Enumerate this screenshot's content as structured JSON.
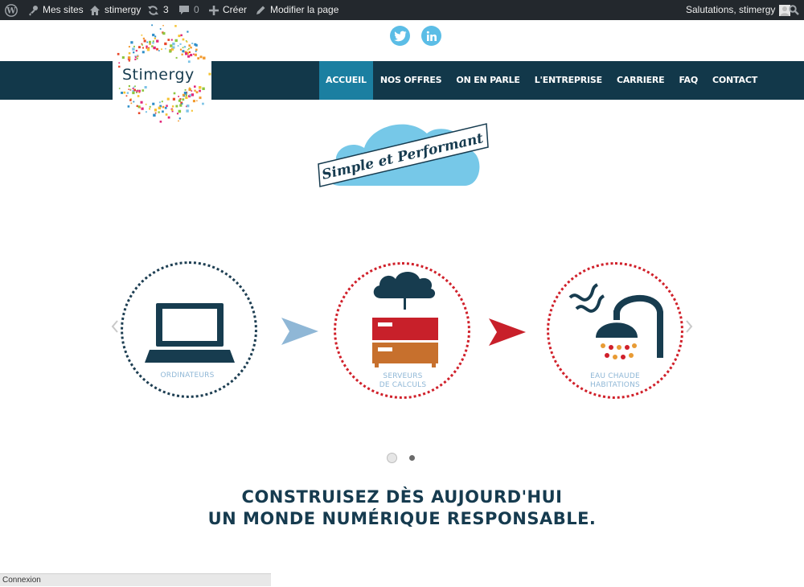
{
  "admin_bar": {
    "wp_logo_icon": "wordpress-icon",
    "my_sites": "Mes sites",
    "site_name": "stimergy",
    "updates_count": "3",
    "comments_count": "0",
    "new_label": "Créer",
    "edit_label": "Modifier la page",
    "greeting": "Salutations, stimergy"
  },
  "logo": {
    "text": "Stimergy"
  },
  "social": {
    "twitter": "twitter-icon",
    "linkedin": "linkedin-icon"
  },
  "nav": {
    "items": [
      {
        "label": "ACCUEIL",
        "active": true
      },
      {
        "label": "NOS OFFRES"
      },
      {
        "label": "ON EN PARLE"
      },
      {
        "label": "L'ENTREPRISE"
      },
      {
        "label": "CARRIERE"
      },
      {
        "label": "FAQ"
      },
      {
        "label": "CONTACT"
      }
    ]
  },
  "tagline": "Simple et Performant",
  "slider": {
    "captions": {
      "computers": "ORDINATEURS",
      "servers_1": "SERVEURS",
      "servers_2": "DE CALCULS",
      "water_1": "EAU CHAUDE",
      "water_2": "HABITATIONS"
    },
    "dots_count": 2
  },
  "headline": {
    "line1": "CONSTRUISEZ DÈS AUJOURD'HUI",
    "line2": "UN MONDE NUMÉRIQUE RESPONSABLE."
  },
  "status_bar": {
    "text": "Connexion"
  },
  "colors": {
    "adminbar": "#23282d",
    "nav": "#12384a",
    "nav_active": "#1b7fa1",
    "accent_red": "#d0202a",
    "cloud_blue": "#76c8e8"
  }
}
